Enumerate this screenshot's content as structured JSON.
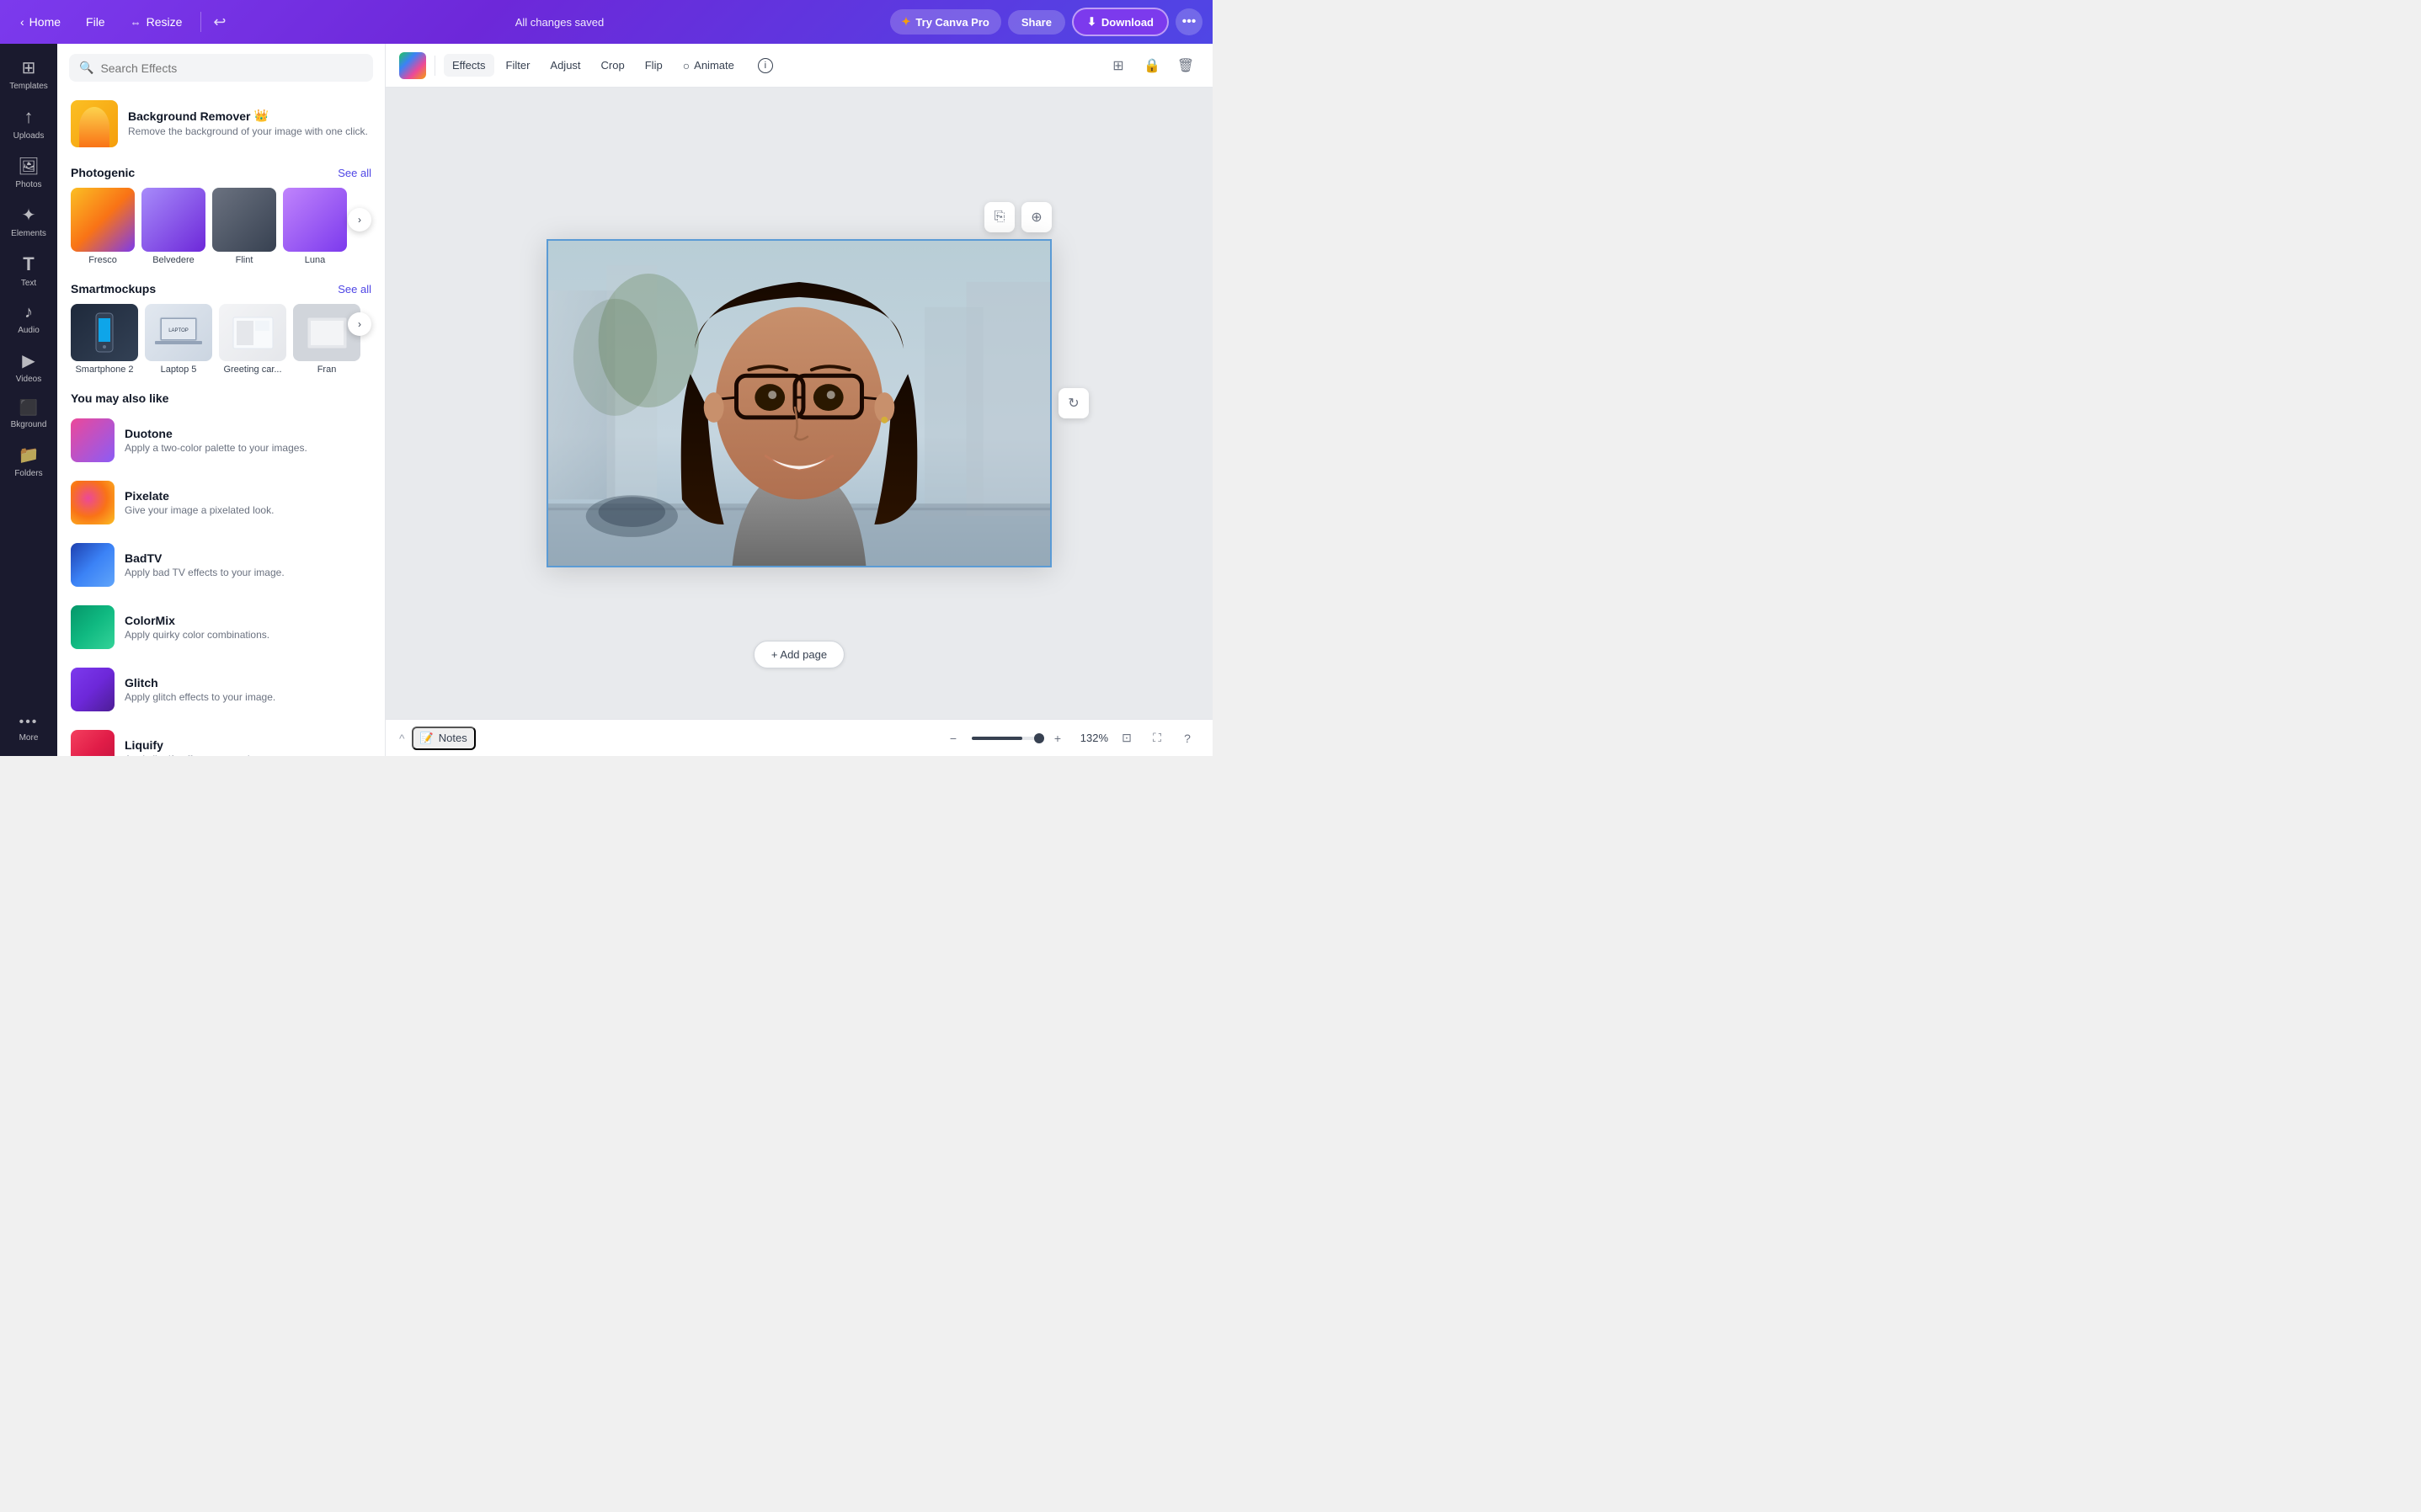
{
  "topbar": {
    "home_label": "Home",
    "file_label": "File",
    "resize_label": "Resize",
    "saved_label": "All changes saved",
    "try_pro_label": "Try Canva Pro",
    "share_label": "Share",
    "download_label": "Download"
  },
  "sidebar": {
    "items": [
      {
        "id": "templates",
        "label": "Templates",
        "icon": "⊞"
      },
      {
        "id": "uploads",
        "label": "Uploads",
        "icon": "↑"
      },
      {
        "id": "photos",
        "label": "Photos",
        "icon": "🖼"
      },
      {
        "id": "elements",
        "label": "Elements",
        "icon": "✦"
      },
      {
        "id": "text",
        "label": "Text",
        "icon": "T"
      },
      {
        "id": "audio",
        "label": "Audio",
        "icon": "♪"
      },
      {
        "id": "videos",
        "label": "Videos",
        "icon": "▶"
      },
      {
        "id": "bkground",
        "label": "Bkground",
        "icon": "⬛"
      },
      {
        "id": "folders",
        "label": "Folders",
        "icon": "📁"
      },
      {
        "id": "more",
        "label": "More",
        "icon": "•••"
      }
    ]
  },
  "effects_panel": {
    "search_placeholder": "Search Effects",
    "bg_remover": {
      "title": "Background Remover",
      "description": "Remove the background of your image with one click."
    },
    "photogenic": {
      "title": "Photogenic",
      "see_all": "See all",
      "items": [
        {
          "label": "Fresco",
          "style": "fresco"
        },
        {
          "label": "Belvedere",
          "style": "belvedere"
        },
        {
          "label": "Flint",
          "style": "flint"
        },
        {
          "label": "Luna",
          "style": "luna"
        }
      ]
    },
    "smartmockups": {
      "title": "Smartmockups",
      "see_all": "See all",
      "items": [
        {
          "label": "Smartphone 2",
          "style": "phone"
        },
        {
          "label": "Laptop 5",
          "style": "laptop"
        },
        {
          "label": "Greeting car...",
          "style": "card"
        },
        {
          "label": "Fran",
          "style": "frame"
        }
      ]
    },
    "you_may_like": {
      "title": "You may also like",
      "items": [
        {
          "id": "duotone",
          "name": "Duotone",
          "description": "Apply a two-color palette to your images.",
          "style": "duotone"
        },
        {
          "id": "pixelate",
          "name": "Pixelate",
          "description": "Give your image a pixelated look.",
          "style": "pixelate"
        },
        {
          "id": "badtv",
          "name": "BadTV",
          "description": "Apply bad TV effects to your image.",
          "style": "badtv"
        },
        {
          "id": "colormix",
          "name": "ColorMix",
          "description": "Apply quirky color combinations.",
          "style": "colormix"
        },
        {
          "id": "glitch",
          "name": "Glitch",
          "description": "Apply glitch effects to your image.",
          "style": "glitch"
        },
        {
          "id": "liquify",
          "name": "Liquify",
          "description": "Apply liquify effects to your image.",
          "style": "liquify"
        }
      ]
    }
  },
  "toolbar": {
    "tabs": [
      {
        "id": "effects",
        "label": "Effects",
        "active": true
      },
      {
        "id": "filter",
        "label": "Filter",
        "active": false
      },
      {
        "id": "adjust",
        "label": "Adjust",
        "active": false
      },
      {
        "id": "crop",
        "label": "Crop",
        "active": false
      },
      {
        "id": "flip",
        "label": "Flip",
        "active": false
      },
      {
        "id": "animate",
        "label": "Animate",
        "active": false
      }
    ]
  },
  "canvas": {
    "add_page_label": "+ Add page"
  },
  "bottombar": {
    "notes_label": "Notes",
    "zoom_percent": "132%",
    "collapse_label": "^"
  }
}
